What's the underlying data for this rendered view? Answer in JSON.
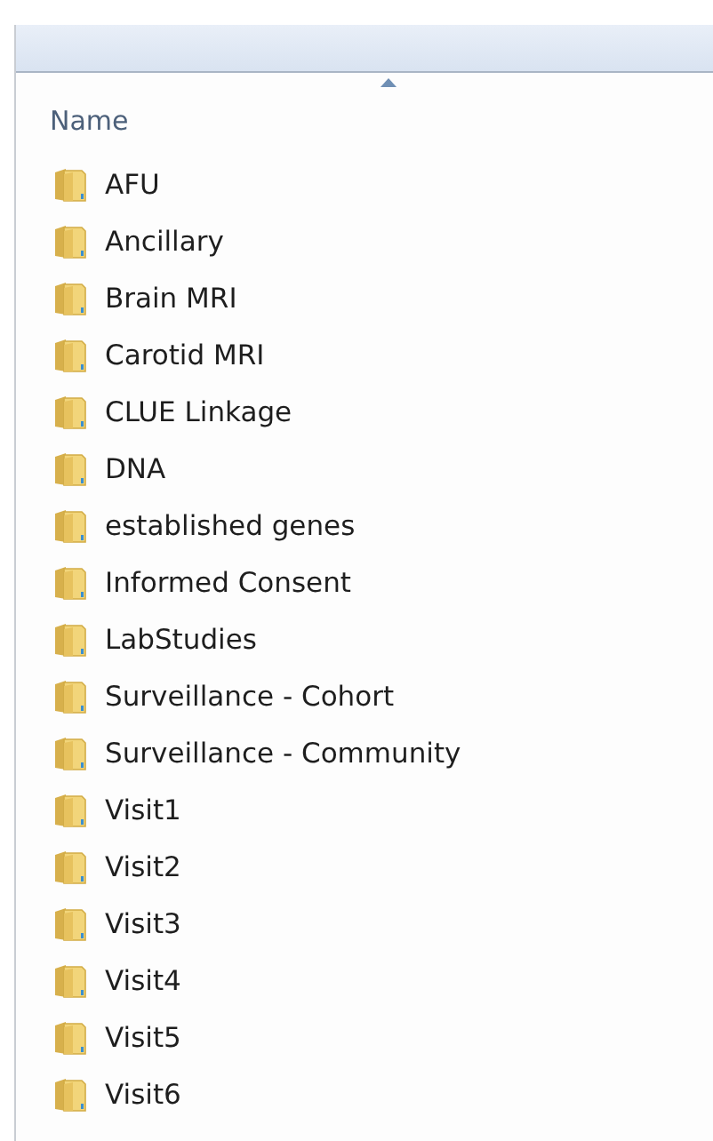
{
  "header": {
    "column": "Name",
    "sorted_ascending": true
  },
  "items": [
    {
      "name": "AFU"
    },
    {
      "name": "Ancillary"
    },
    {
      "name": "Brain MRI"
    },
    {
      "name": "Carotid MRI"
    },
    {
      "name": "CLUE Linkage"
    },
    {
      "name": "DNA"
    },
    {
      "name": "established genes"
    },
    {
      "name": "Informed Consent"
    },
    {
      "name": "LabStudies"
    },
    {
      "name": "Surveillance - Cohort"
    },
    {
      "name": "Surveillance - Community"
    },
    {
      "name": "Visit1"
    },
    {
      "name": "Visit2"
    },
    {
      "name": "Visit3"
    },
    {
      "name": "Visit4"
    },
    {
      "name": "Visit5"
    },
    {
      "name": "Visit6"
    }
  ]
}
